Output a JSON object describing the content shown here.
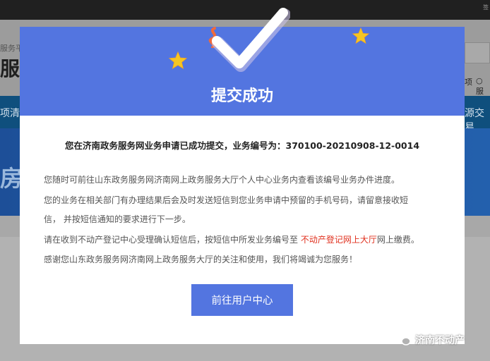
{
  "background": {
    "topbar_right": "签",
    "header_small": "服务平",
    "header_big": "服",
    "search_radio_1": "项",
    "search_radio_2": "○ 服",
    "nav_left": "项清单",
    "nav_right": "源交易",
    "banner_text": "房"
  },
  "modal": {
    "title": "提交成功",
    "success_prefix": "您在济南政务服务网业务申请已成功提交，业务编号为：",
    "business_number": "370100-20210908-12-0014",
    "info_1": "您随时可前往山东政务服务网济南网上政务服务大厅个人中心业务内查看该编号业务办件进度。",
    "info_2": "您的业务在相关部门有办理结果后会及时发送短信到您业务申请中预留的手机号码，请留意接收短",
    "info_3": "信，  并按短信通知的要求进行下一步。",
    "info_4_before": "请在收到不动产登记中心受理确认短信后，按短信中所发业务编号至 ",
    "info_4_link": "不动产登记网上大厅",
    "info_4_after": "网上缴费。",
    "info_5": "感谢您山东政务服务网济南网上政务服务大厅的关注和使用，我们将竭诚为您服务！",
    "button_label": "前往用户中心"
  },
  "watermark": {
    "text": "济南不动产",
    "icon": "wechat-bubble-icon"
  },
  "colors": {
    "modal_header": "#5375e0",
    "button": "#5375e0",
    "highlight": "#e0301e",
    "star": "#f5c623",
    "squiggle": "#f06a3c"
  }
}
